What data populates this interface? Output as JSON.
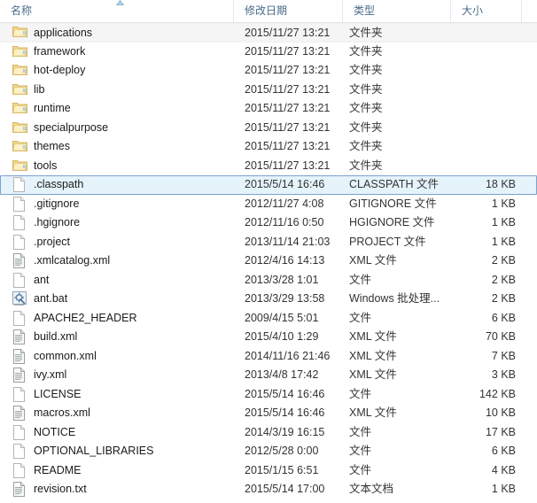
{
  "header": {
    "sort_indicator": "sort-ascending-icon",
    "columns": [
      {
        "id": "name",
        "label": "名称"
      },
      {
        "id": "date",
        "label": "修改日期"
      },
      {
        "id": "type",
        "label": "类型"
      },
      {
        "id": "size",
        "label": "大小"
      }
    ]
  },
  "rows": [
    {
      "name": "applications",
      "date": "2015/11/27 13:21",
      "type": "文件夹",
      "size": "",
      "icon": "folder-icon",
      "state": "hovered"
    },
    {
      "name": "framework",
      "date": "2015/11/27 13:21",
      "type": "文件夹",
      "size": "",
      "icon": "folder-icon",
      "state": "normal"
    },
    {
      "name": "hot-deploy",
      "date": "2015/11/27 13:21",
      "type": "文件夹",
      "size": "",
      "icon": "folder-icon",
      "state": "normal"
    },
    {
      "name": "lib",
      "date": "2015/11/27 13:21",
      "type": "文件夹",
      "size": "",
      "icon": "folder-icon",
      "state": "normal"
    },
    {
      "name": "runtime",
      "date": "2015/11/27 13:21",
      "type": "文件夹",
      "size": "",
      "icon": "folder-icon",
      "state": "normal"
    },
    {
      "name": "specialpurpose",
      "date": "2015/11/27 13:21",
      "type": "文件夹",
      "size": "",
      "icon": "folder-icon",
      "state": "normal"
    },
    {
      "name": "themes",
      "date": "2015/11/27 13:21",
      "type": "文件夹",
      "size": "",
      "icon": "folder-icon",
      "state": "normal"
    },
    {
      "name": "tools",
      "date": "2015/11/27 13:21",
      "type": "文件夹",
      "size": "",
      "icon": "folder-icon",
      "state": "normal"
    },
    {
      "name": ".classpath",
      "date": "2015/5/14 16:46",
      "type": "CLASSPATH 文件",
      "size": "18 KB",
      "icon": "blank-document-icon",
      "state": "selected"
    },
    {
      "name": ".gitignore",
      "date": "2012/11/27 4:08",
      "type": "GITIGNORE 文件",
      "size": "1 KB",
      "icon": "blank-document-icon",
      "state": "normal"
    },
    {
      "name": ".hgignore",
      "date": "2012/11/16 0:50",
      "type": "HGIGNORE 文件",
      "size": "1 KB",
      "icon": "blank-document-icon",
      "state": "normal"
    },
    {
      "name": ".project",
      "date": "2013/11/14 21:03",
      "type": "PROJECT 文件",
      "size": "1 KB",
      "icon": "blank-document-icon",
      "state": "normal"
    },
    {
      "name": ".xmlcatalog.xml",
      "date": "2012/4/16 14:13",
      "type": "XML 文件",
      "size": "2 KB",
      "icon": "text-document-icon",
      "state": "normal"
    },
    {
      "name": "ant",
      "date": "2013/3/28 1:01",
      "type": "文件",
      "size": "2 KB",
      "icon": "blank-document-icon",
      "state": "normal"
    },
    {
      "name": "ant.bat",
      "date": "2013/3/29 13:58",
      "type": "Windows 批处理...",
      "size": "2 KB",
      "icon": "gear-icon",
      "state": "normal"
    },
    {
      "name": "APACHE2_HEADER",
      "date": "2009/4/15 5:01",
      "type": "文件",
      "size": "6 KB",
      "icon": "blank-document-icon",
      "state": "normal"
    },
    {
      "name": "build.xml",
      "date": "2015/4/10 1:29",
      "type": "XML 文件",
      "size": "70 KB",
      "icon": "text-document-icon",
      "state": "normal"
    },
    {
      "name": "common.xml",
      "date": "2014/11/16 21:46",
      "type": "XML 文件",
      "size": "7 KB",
      "icon": "text-document-icon",
      "state": "normal"
    },
    {
      "name": "ivy.xml",
      "date": "2013/4/8 17:42",
      "type": "XML 文件",
      "size": "3 KB",
      "icon": "text-document-icon",
      "state": "normal"
    },
    {
      "name": "LICENSE",
      "date": "2015/5/14 16:46",
      "type": "文件",
      "size": "142 KB",
      "icon": "blank-document-icon",
      "state": "normal"
    },
    {
      "name": "macros.xml",
      "date": "2015/5/14 16:46",
      "type": "XML 文件",
      "size": "10 KB",
      "icon": "text-document-icon",
      "state": "normal"
    },
    {
      "name": "NOTICE",
      "date": "2014/3/19 16:15",
      "type": "文件",
      "size": "17 KB",
      "icon": "blank-document-icon",
      "state": "normal"
    },
    {
      "name": "OPTIONAL_LIBRARIES",
      "date": "2012/5/28 0:00",
      "type": "文件",
      "size": "6 KB",
      "icon": "blank-document-icon",
      "state": "normal"
    },
    {
      "name": "README",
      "date": "2015/1/15 6:51",
      "type": "文件",
      "size": "4 KB",
      "icon": "blank-document-icon",
      "state": "normal"
    },
    {
      "name": "revision.txt",
      "date": "2015/5/14 17:00",
      "type": "文本文档",
      "size": "1 KB",
      "icon": "text-document-icon",
      "state": "normal"
    }
  ],
  "colors": {
    "selection_fill": "#e5f3fb",
    "selection_border": "#7da2ce",
    "hover_fill": "#f5f5f5",
    "header_text": "#4a6b8a",
    "folder_icon": "#f8dd8f",
    "sort_arrow": "#3f7fb6"
  }
}
